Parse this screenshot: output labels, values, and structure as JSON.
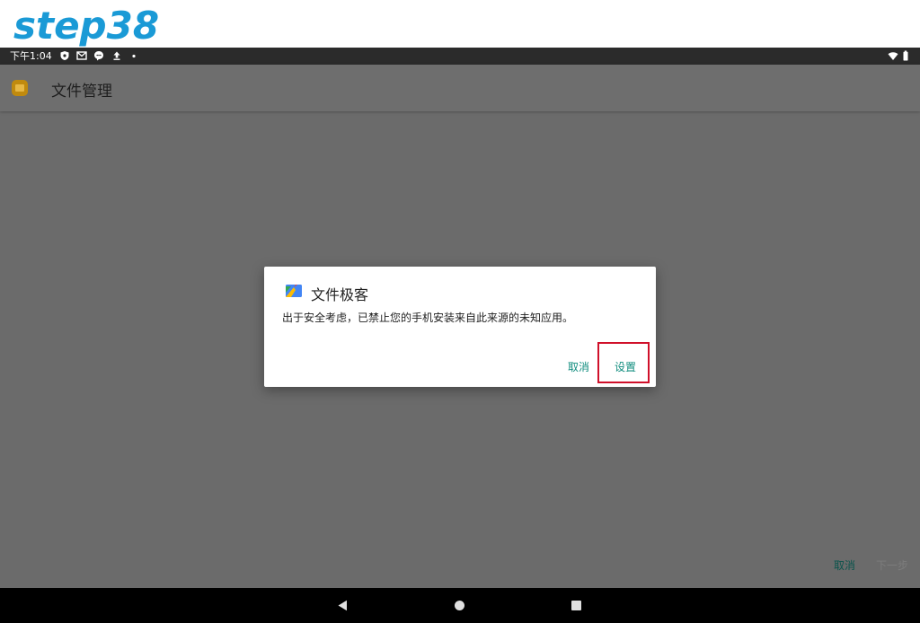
{
  "banner": {
    "logo_text": "step38",
    "logo_color": "#1a9ad6"
  },
  "status_bar": {
    "time": "下午1:04",
    "icons": [
      "shield-icon",
      "gmail-icon",
      "message-icon",
      "upload-icon",
      "dot-icon",
      "wifi-icon",
      "battery-icon"
    ]
  },
  "app_bar": {
    "title": "文件管理",
    "icon": "folder-icon"
  },
  "dialog": {
    "icon": "files-app-icon",
    "title": "文件极客",
    "message": "出于安全考虑，已禁止您的手机安装来自此来源的未知应用。",
    "buttons": {
      "cancel": "取消",
      "settings": "设置"
    },
    "accent": "#0f8c7e",
    "highlight_color": "#d0102a"
  },
  "bottom_actions": {
    "cancel": "取消",
    "next": "下一步"
  },
  "nav_bar": {
    "buttons": [
      "back-icon",
      "home-icon",
      "recents-icon"
    ]
  }
}
